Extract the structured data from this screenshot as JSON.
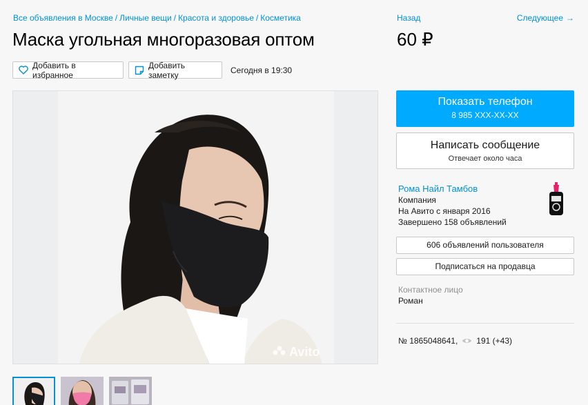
{
  "breadcrumbs": [
    "Все объявления в Москве",
    "Личные вещи",
    "Красота и здоровье",
    "Косметика"
  ],
  "breadcrumb_separator": "/",
  "nav": {
    "back_label": "Назад",
    "next_label": "Следующее",
    "next_arrow": "→"
  },
  "listing": {
    "title": "Маска угольная многоразовая оптом",
    "price": "60 ₽",
    "published": "Сегодня в 19:30",
    "item_number": "№ 1865048641,",
    "views": "191 (+43)"
  },
  "actions": {
    "favorite_label": "Добавить в избранное",
    "note_label": "Добавить заметку"
  },
  "contact": {
    "phone_button_label": "Показать телефон",
    "phone_masked": "8 985 XXX-XX-XX",
    "message_button_label": "Написать сообщение",
    "message_response": "Отвечает около часа"
  },
  "seller": {
    "name": "Рома Найл Тамбов",
    "type": "Компания",
    "since": "На Авито с января 2016",
    "completed": "Завершено 158 объявлений",
    "ads_button_label": "606 объявлений пользователя",
    "subscribe_button_label": "Подписаться на продавца",
    "contact_person_label": "Контактное лицо",
    "contact_person_name": "Роман"
  },
  "gallery": {
    "watermark": "Avito",
    "thumbnail_count": 3
  },
  "icons": {
    "favorite": "heart-icon",
    "note": "note-icon",
    "views": "eye-icon"
  },
  "colors": {
    "link": "#0091d9",
    "primary_button": "#00aaff",
    "mask": "#1c1c1e"
  }
}
